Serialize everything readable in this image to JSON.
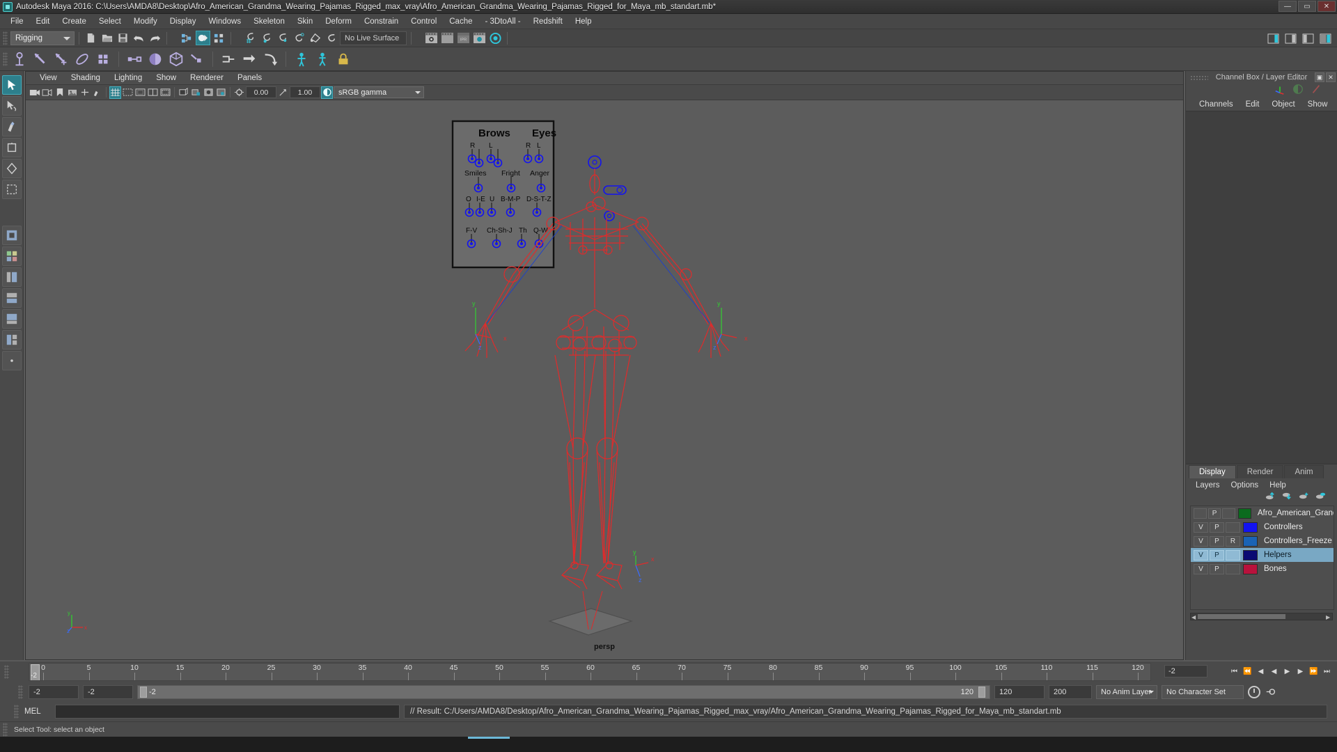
{
  "window": {
    "title": "Autodesk Maya 2016: C:\\Users\\AMDA8\\Desktop\\Afro_American_Grandma_Wearing_Pajamas_Rigged_max_vray\\Afro_American_Grandma_Wearing_Pajamas_Rigged_for_Maya_mb_standart.mb*",
    "minimize": "—",
    "maximize": "▭",
    "close": "✕"
  },
  "menubar": {
    "items": [
      "File",
      "Edit",
      "Create",
      "Select",
      "Modify",
      "Display",
      "Windows",
      "Skeleton",
      "Skin",
      "Deform",
      "Constrain",
      "Control",
      "Cache",
      "- 3DtoAll -",
      "Redshift",
      "Help"
    ]
  },
  "statusline": {
    "menu_set": "Rigging",
    "live_surface": "No Live Surface"
  },
  "viewport": {
    "menus": [
      "View",
      "Shading",
      "Lighting",
      "Show",
      "Renderer",
      "Panels"
    ],
    "exposure": "0.00",
    "gamma_value": "1.00",
    "color_profile": "sRGB gamma",
    "camera_label": "persp",
    "axis": {
      "x": "x",
      "y": "y",
      "z": "z"
    }
  },
  "facial_panel": {
    "groups": [
      "Brows",
      "Eyes"
    ],
    "brow_sides": [
      "R",
      "L"
    ],
    "eye_sides": [
      "R",
      "L"
    ],
    "row2": [
      "Smiles",
      "Fright",
      "Anger"
    ],
    "row3": [
      "O",
      "I-E",
      "U",
      "B-M-P",
      "D-S-T-Z"
    ],
    "row4": [
      "F-V",
      "Ch-Sh-J",
      "Th",
      "Q-W"
    ]
  },
  "channel_box": {
    "title": "Channel Box / Layer Editor",
    "menus": [
      "Channels",
      "Edit",
      "Object",
      "Show"
    ]
  },
  "layer_editor": {
    "tabs": [
      "Display",
      "Render",
      "Anim"
    ],
    "active_tab": "Display",
    "menus": [
      "Layers",
      "Options",
      "Help"
    ],
    "layers": [
      {
        "v": "",
        "p": "P",
        "r": "",
        "color": "#0b6b1e",
        "name": "Afro_American_Grandm",
        "selected": false
      },
      {
        "v": "V",
        "p": "P",
        "r": "",
        "color": "#1313f0",
        "name": "Controllers",
        "selected": false
      },
      {
        "v": "V",
        "p": "P",
        "r": "R",
        "color": "#1a63b5",
        "name": "Controllers_Freeze",
        "selected": false
      },
      {
        "v": "V",
        "p": "P",
        "r": "",
        "color": "#0a0a72",
        "name": "Helpers",
        "selected": true
      },
      {
        "v": "V",
        "p": "P",
        "r": "",
        "color": "#b8123c",
        "name": "Bones",
        "selected": false
      }
    ]
  },
  "timeline": {
    "ticks": [
      "0",
      "5",
      "10",
      "15",
      "20",
      "25",
      "30",
      "35",
      "40",
      "45",
      "50",
      "55",
      "60",
      "65",
      "70",
      "75",
      "80",
      "85",
      "90",
      "95",
      "100",
      "105",
      "110",
      "115",
      "120"
    ],
    "current_frame": "-2",
    "current_frame_field": "-2"
  },
  "range": {
    "start": "-2",
    "anim_start": "-2",
    "slider_start": "-2",
    "slider_end": "120",
    "anim_end": "120",
    "end": "200",
    "anim_layer": "No Anim Layer",
    "character_set": "No Character Set"
  },
  "command_line": {
    "label": "MEL",
    "input_value": "",
    "output": "// Result: C:/Users/AMDA8/Desktop/Afro_American_Grandma_Wearing_Pajamas_Rigged_max_vray/Afro_American_Grandma_Wearing_Pajamas_Rigged_for_Maya_mb_standart.mb"
  },
  "help_line": {
    "text": "Select Tool: select an object"
  },
  "colors": {
    "accent": "#2d7f8c",
    "rig_bones": "#e02b2b",
    "controllers": "#1313f0",
    "selection": "#79a8c4",
    "background": "#5c5c5c"
  }
}
